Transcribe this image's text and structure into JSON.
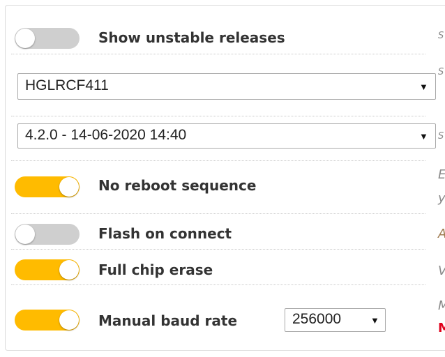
{
  "options": {
    "show_unstable_releases": {
      "label": "Show unstable releases",
      "enabled": false
    },
    "board_select": {
      "value": "HGLRCF411"
    },
    "firmware_select": {
      "value": "4.2.0 - 14-06-2020 14:40"
    },
    "no_reboot_sequence": {
      "label": "No reboot sequence",
      "enabled": true
    },
    "flash_on_connect": {
      "label": "Flash on connect",
      "enabled": false
    },
    "full_chip_erase": {
      "label": "Full chip erase",
      "enabled": true
    },
    "manual_baud_rate": {
      "label": "Manual baud rate",
      "enabled": true,
      "baud_value": "256000"
    }
  },
  "side_text": {
    "row1": "S",
    "row2": "S",
    "row3": "S",
    "row4a": "E",
    "row4b": "y",
    "row5": "A",
    "row6": "V",
    "row7a": "M",
    "row7b": "M"
  },
  "icons": {
    "dropdown": "dropdown-arrow-icon"
  },
  "colors": {
    "toggle_on": "#ffbb00",
    "toggle_off": "#cfcfcf",
    "label": "#333333",
    "warning_red": "#e0001b"
  }
}
